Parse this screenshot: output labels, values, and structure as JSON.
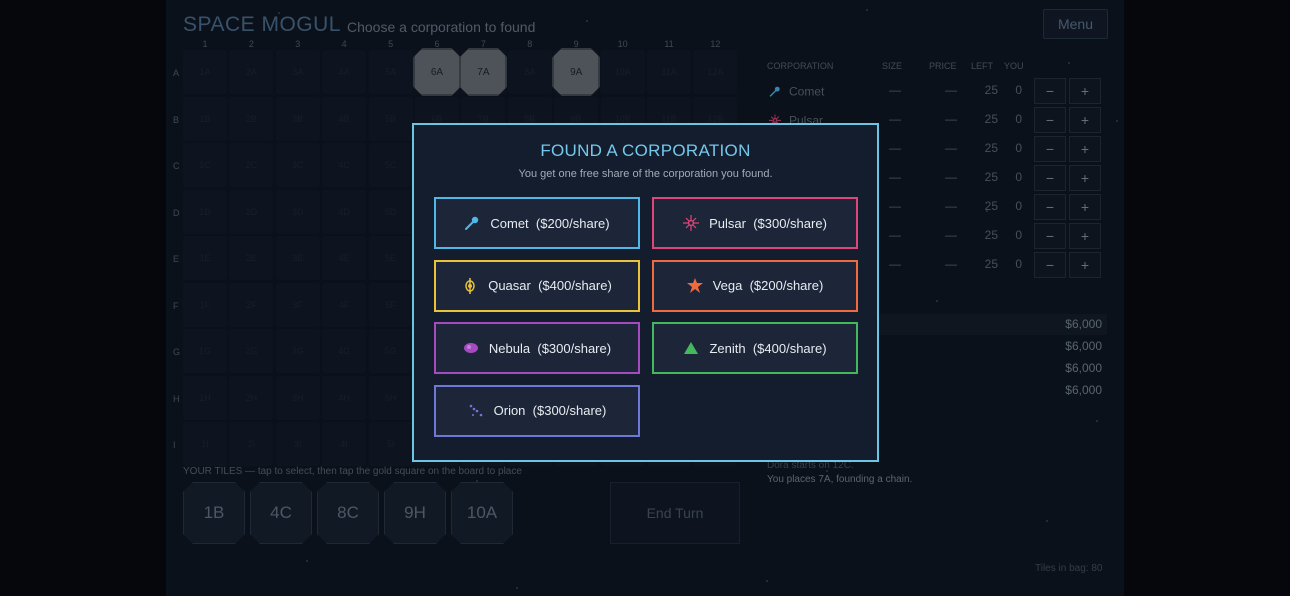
{
  "header": {
    "title": "SPACE MOGUL",
    "subtitle": "Choose a corporation to found",
    "menu_label": "Menu"
  },
  "board": {
    "columns": [
      "1",
      "2",
      "3",
      "4",
      "5",
      "6",
      "7",
      "8",
      "9",
      "10",
      "11",
      "12"
    ],
    "rows": [
      "A",
      "B",
      "C",
      "D",
      "E",
      "F",
      "G",
      "H",
      "I"
    ],
    "placed_tiles": [
      {
        "label": "6A",
        "col": 6,
        "row": "A"
      },
      {
        "label": "7A",
        "col": 7,
        "row": "A"
      },
      {
        "label": "9A",
        "col": 9,
        "row": "A"
      }
    ]
  },
  "hand": {
    "label": "YOUR TILES — tap to select, then tap the gold square on the board to place",
    "tiles": [
      "1B",
      "4C",
      "8C",
      "9H",
      "10A"
    ],
    "end_turn_label": "End Turn"
  },
  "corporations_table": {
    "headers": {
      "corporation": "CORPORATION",
      "size": "SIZE",
      "price": "PRICE",
      "left": "LEFT",
      "you": "YOU"
    },
    "rows": [
      {
        "name": "Comet",
        "size": "—",
        "price": "—",
        "left": "25",
        "you": "0",
        "minus": "−",
        "plus": "+"
      },
      {
        "name": "Pulsar",
        "size": "—",
        "price": "—",
        "left": "25",
        "you": "0",
        "minus": "−",
        "plus": "+"
      },
      {
        "name": "",
        "size": "—",
        "price": "—",
        "left": "25",
        "you": "0",
        "minus": "−",
        "plus": "+"
      },
      {
        "name": "",
        "size": "—",
        "price": "—",
        "left": "25",
        "you": "0",
        "minus": "−",
        "plus": "+"
      },
      {
        "name": "",
        "size": "—",
        "price": "—",
        "left": "25",
        "you": "0",
        "minus": "−",
        "plus": "+"
      },
      {
        "name": "",
        "size": "—",
        "price": "—",
        "left": "25",
        "you": "0",
        "minus": "−",
        "plus": "+"
      },
      {
        "name": "",
        "size": "—",
        "price": "—",
        "left": "25",
        "you": "0",
        "minus": "−",
        "plus": "+"
      }
    ]
  },
  "players": {
    "money": [
      "$6,000",
      "$6,000",
      "$6,000",
      "$6,000"
    ]
  },
  "log": [
    "Dora starts on 12C.",
    "You places 7A, founding a chain."
  ],
  "bag": "Tiles in bag: 80",
  "modal": {
    "title": "FOUND A CORPORATION",
    "subtitle": "You get one free share of the corporation you found.",
    "options": [
      {
        "name": "Comet",
        "price": "($200/share)",
        "color": "#4fb8e8",
        "icon": "comet-icon"
      },
      {
        "name": "Pulsar",
        "price": "($300/share)",
        "color": "#e0457a",
        "icon": "pulsar-icon"
      },
      {
        "name": "Quasar",
        "price": "($400/share)",
        "color": "#e8c23a",
        "icon": "quasar-icon"
      },
      {
        "name": "Vega",
        "price": "($200/share)",
        "color": "#ef6a3c",
        "icon": "vega-icon"
      },
      {
        "name": "Nebula",
        "price": "($300/share)",
        "color": "#a54bc0",
        "icon": "nebula-icon"
      },
      {
        "name": "Zenith",
        "price": "($400/share)",
        "color": "#43b85c",
        "icon": "zenith-icon"
      },
      {
        "name": "Orion",
        "price": "($300/share)",
        "color": "#6e78d6",
        "icon": "orion-icon"
      }
    ]
  }
}
